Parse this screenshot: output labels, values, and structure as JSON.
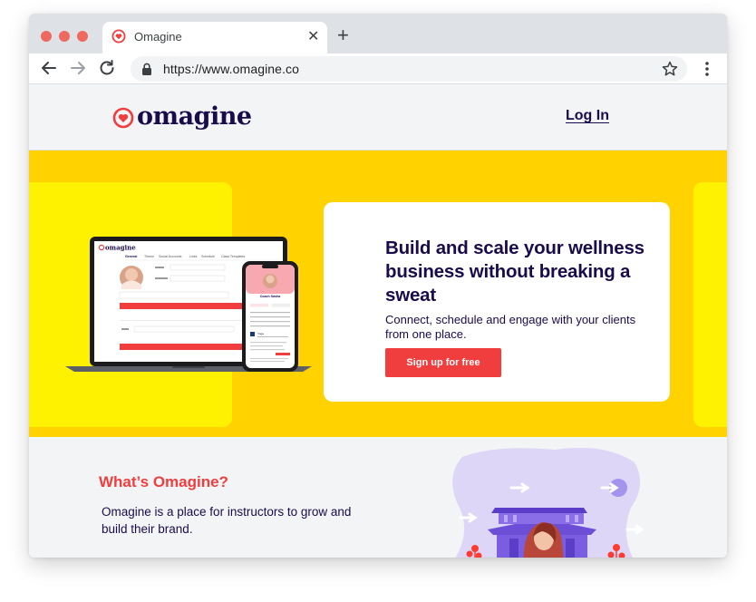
{
  "browser": {
    "tab_title": "Omagine",
    "url": "https://www.omagine.co"
  },
  "header": {
    "logo_text": "omagine",
    "login_label": "Log In"
  },
  "hero": {
    "headline": "Build and scale your wellness business without breaking a sweat",
    "subhead": "Connect, schedule and engage with your clients from one place.",
    "cta_label": "Sign up for free"
  },
  "mockup": {
    "laptop_logo": "omagine",
    "laptop_tabs": [
      "General",
      "Theme",
      "Social Accounts",
      "Links",
      "Schedule",
      "Class Templates"
    ],
    "phone_name": "Coach Sasha",
    "phone_title": "Yoga"
  },
  "about": {
    "title": "What’s Omagine?",
    "text": "Omagine is a place for instructors to grow and build their brand."
  },
  "colors": {
    "brand_navy": "#1a0b4b",
    "brand_red": "#f03d3d",
    "hero_yellow": "#ffd200",
    "panel_yellow": "#fff200"
  }
}
